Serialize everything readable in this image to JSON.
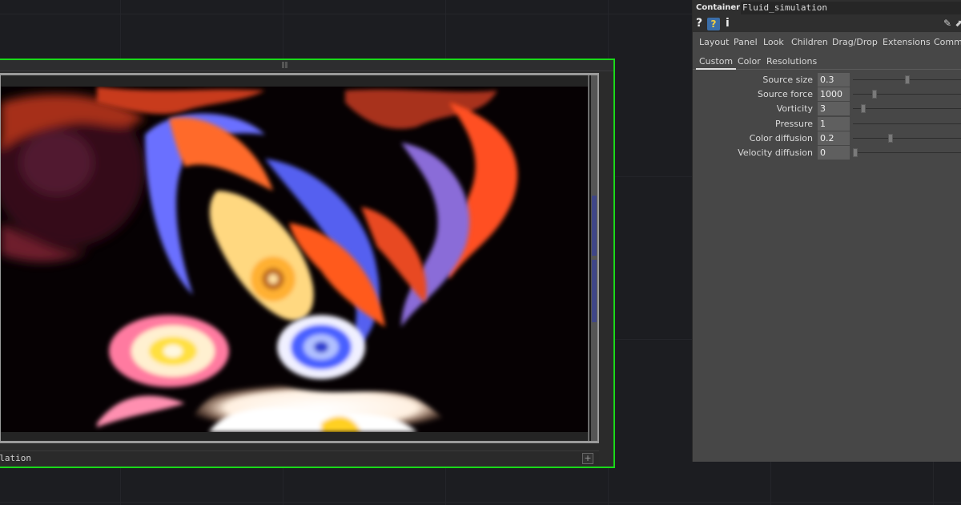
{
  "node": {
    "label_prefix": "",
    "label": "mulation",
    "add_glyph": "+"
  },
  "panel": {
    "op_type": "Container",
    "op_name": "Fluid_simulation",
    "icons": [
      "help-icon",
      "python-help-icon",
      "info-icon",
      "edit-icon",
      "pin-icon"
    ],
    "help_glyph": "?",
    "py_help_glyph": "?",
    "info_glyph": "i",
    "edit_glyph": "✎",
    "pin_glyph": "⬈",
    "page_tabs": [
      "Layout",
      "Panel",
      "Look",
      "Children",
      "Drag/Drop",
      "Extensions",
      "Commo"
    ],
    "custom_tabs": [
      "Custom",
      "Color",
      "Resolutions"
    ],
    "active_custom_tab": "Custom",
    "params": [
      {
        "label": "Source size",
        "value": "0.3",
        "slider": 0.48
      },
      {
        "label": "Source force",
        "value": "1000",
        "slider": 0.18
      },
      {
        "label": "Vorticity",
        "value": "3",
        "slider": 0.07
      },
      {
        "label": "Pressure",
        "value": "1",
        "slider": null
      },
      {
        "label": "Color diffusion",
        "value": "0.2",
        "slider": 0.32
      },
      {
        "label": "Velocity diffusion",
        "value": "0",
        "slider": 0.0
      }
    ]
  },
  "colors": {
    "selection_outline": "#19d919",
    "panel_bg": "#474747",
    "canvas_bg": "#1c1d21",
    "fluid_palette": [
      "#ff4a1a",
      "#ffb23a",
      "#ffffff",
      "#6c78ff",
      "#c0305a",
      "#3b1020"
    ]
  }
}
